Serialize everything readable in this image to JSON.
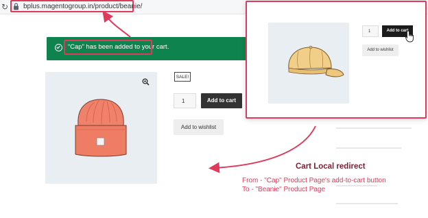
{
  "browser": {
    "url": "bplus.magentogroup.in/product/beanie/"
  },
  "notice": {
    "message": "“Cap” has been added to your cart."
  },
  "beanie_page": {
    "sale_badge": "SALE!",
    "quantity": "1",
    "add_to_cart_label": "Add to cart",
    "wishlist_label": "Add to wishlist"
  },
  "cap_page": {
    "quantity": "1",
    "add_to_cart_label": "Add to cart",
    "wishlist_label": "Add to wishlist"
  },
  "caption": {
    "title": "Cart Local redirect",
    "line1": "From - \"Cap\" Product Page's add-to-cart button",
    "line2": "To - \"Beanie\" Product Page"
  },
  "colors": {
    "accent": "#e0395b",
    "notice_green": "#0f834d",
    "button_dark": "#333333",
    "caption_title": "#7a1e32"
  }
}
